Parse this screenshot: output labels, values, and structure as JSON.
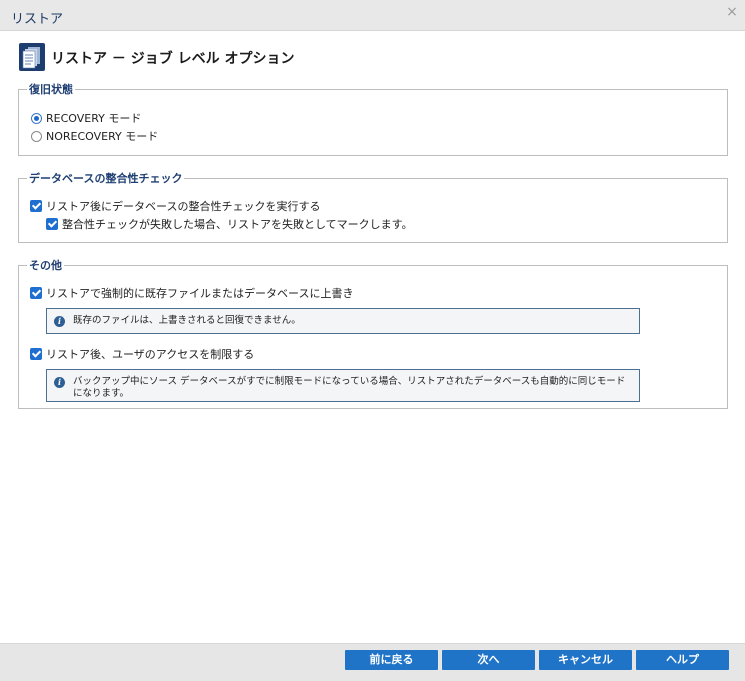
{
  "window": {
    "title": "リストア",
    "close_glyph": "×"
  },
  "header": {
    "title": "リストア － ジョブ レベル オプション",
    "icon": "document-stack-icon"
  },
  "recovery_state": {
    "legend": "復旧状態",
    "options": [
      {
        "label": "RECOVERY モード",
        "selected": true
      },
      {
        "label": "NORECOVERY モード",
        "selected": false
      }
    ]
  },
  "consistency_check": {
    "legend": "データベースの整合性チェック",
    "run_check": {
      "label": "リストア後にデータベースの整合性チェックを実行する",
      "checked": true
    },
    "mark_failed": {
      "label": "整合性チェックが失敗した場合、リストアを失敗としてマークします。",
      "checked": true
    }
  },
  "other": {
    "legend": "その他",
    "force_overwrite": {
      "label": "リストアで強制的に既存ファイルまたはデータベースに上書き",
      "checked": true
    },
    "overwrite_info": "既存のファイルは、上書きされると回復できません。",
    "restrict_access": {
      "label": "リストア後、ユーザのアクセスを制限する",
      "checked": true
    },
    "restrict_info": "バックアップ中にソース データベースがすでに制限モードになっている場合、リストアされたデータベースも自動的に同じモードになります。"
  },
  "footer": {
    "back_label": "前に戻る",
    "next_label": "次へ",
    "cancel_label": "キャンセル",
    "help_label": "ヘルプ"
  },
  "colors": {
    "accent": "#1f74c8",
    "legend": "#1f3f73",
    "title": "#1f3a66"
  }
}
